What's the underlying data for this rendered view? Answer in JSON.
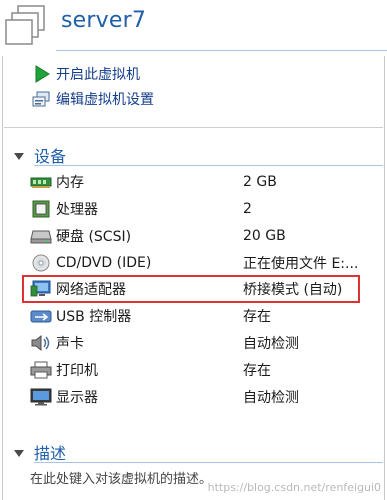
{
  "vm": {
    "title": "server7"
  },
  "actions": {
    "start_label": "开启此虚拟机",
    "edit_label": "编辑虚拟机设置"
  },
  "devices_section": {
    "title": "设备",
    "items": [
      {
        "name": "内存",
        "value": "2 GB",
        "icon": "memory-icon"
      },
      {
        "name": "处理器",
        "value": "2",
        "icon": "processor-icon"
      },
      {
        "name": "硬盘 (SCSI)",
        "value": "20 GB",
        "icon": "hard-disk-icon"
      },
      {
        "name": "CD/DVD (IDE)",
        "value": "正在使用文件 E:...",
        "icon": "cd-dvd-icon"
      },
      {
        "name": "网络适配器",
        "value": "桥接模式 (自动)",
        "icon": "network-adapter-icon"
      },
      {
        "name": "USB 控制器",
        "value": "存在",
        "icon": "usb-icon"
      },
      {
        "name": "声卡",
        "value": "自动检测",
        "icon": "sound-icon"
      },
      {
        "name": "打印机",
        "value": "存在",
        "icon": "printer-icon"
      },
      {
        "name": "显示器",
        "value": "自动检测",
        "icon": "display-icon"
      }
    ]
  },
  "description_section": {
    "title": "描述",
    "placeholder": "在此处键入对该虚拟机的描述。"
  },
  "watermark": "https://blog.csdn.net/renfeigui0",
  "colors": {
    "accent": "#1f5fa8",
    "highlight": "#e03131",
    "link": "#153e8a"
  }
}
